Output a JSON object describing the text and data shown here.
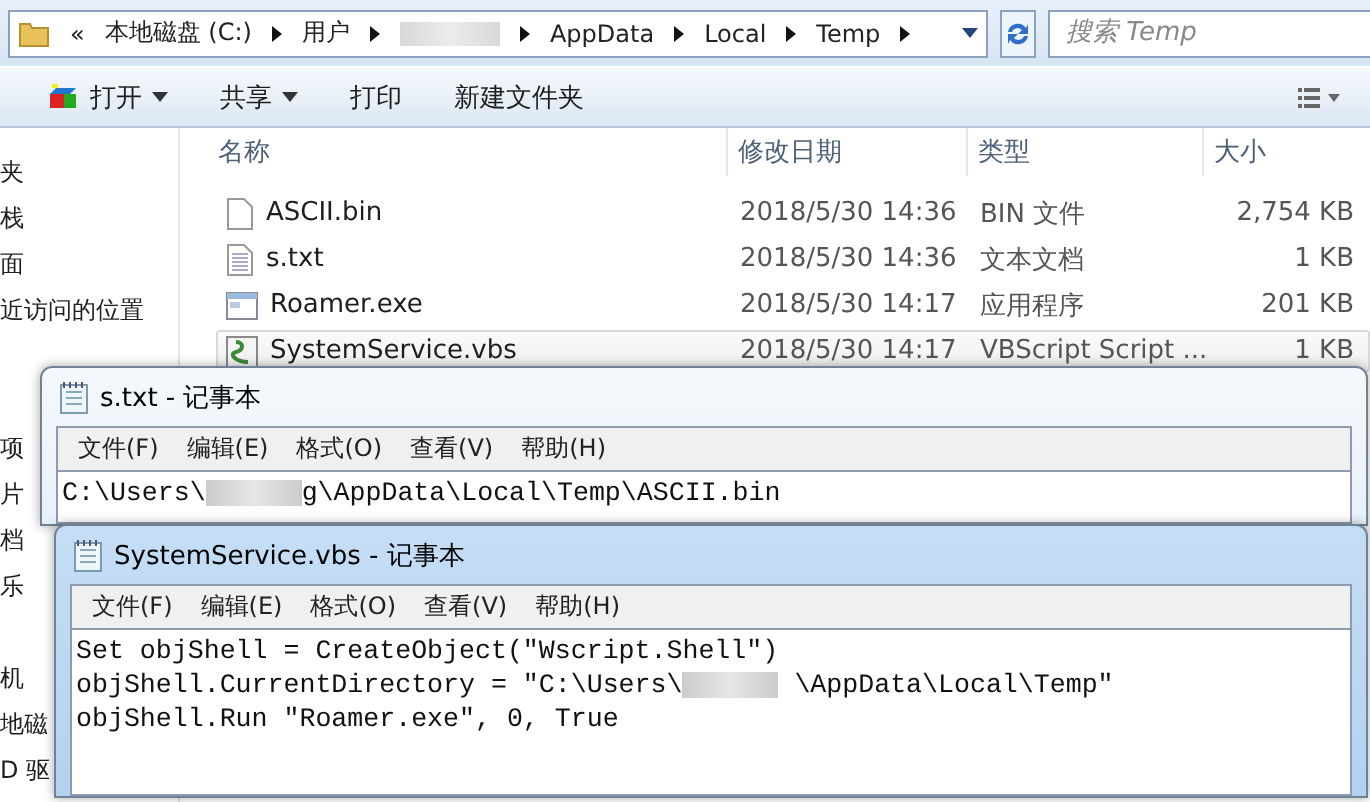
{
  "explorer": {
    "address": {
      "overflow": "«",
      "crumbs": [
        {
          "kind": "text",
          "text": "本地磁盘 (C:)"
        },
        {
          "kind": "text",
          "text": "用户"
        },
        {
          "kind": "redacted"
        },
        {
          "kind": "text",
          "text": "AppData"
        },
        {
          "kind": "text",
          "text": "Local"
        },
        {
          "kind": "text",
          "text": "Temp"
        }
      ]
    },
    "search": {
      "placeholder": "搜索 Temp"
    },
    "toolbar": [
      {
        "label": "打开",
        "kind": "icon-menu"
      },
      {
        "label": "共享",
        "kind": "menu"
      },
      {
        "label": "打印",
        "kind": "plain"
      },
      {
        "label": "新建文件夹",
        "kind": "plain"
      }
    ],
    "sidebar": [
      [
        "夹",
        "栈",
        "面",
        "近访问的位置"
      ],
      [
        "项",
        "片",
        "档",
        "乐"
      ],
      [
        "机",
        "地磁",
        "D 驱"
      ]
    ],
    "columns": [
      "名称",
      "修改日期",
      "类型",
      "大小"
    ],
    "files": [
      {
        "name": "ASCII.bin",
        "modified": "2018/5/30 14:36",
        "type": "BIN 文件",
        "size": "2,754 KB",
        "kind": "blank",
        "selected": false
      },
      {
        "name": "s.txt",
        "modified": "2018/5/30 14:36",
        "type": "文本文档",
        "size": "1 KB",
        "kind": "text",
        "selected": false
      },
      {
        "name": "Roamer.exe",
        "modified": "2018/5/30 14:17",
        "type": "应用程序",
        "size": "201 KB",
        "kind": "app",
        "selected": false
      },
      {
        "name": "SystemService.vbs",
        "modified": "2018/5/30 14:17",
        "type": "VBScript Script ...",
        "size": "1 KB",
        "kind": "script",
        "selected": true
      }
    ]
  },
  "notepads": [
    {
      "title": "s.txt - 记事本",
      "active": false,
      "menu": [
        "文件(F)",
        "编辑(E)",
        "格式(O)",
        "查看(V)",
        "帮助(H)"
      ],
      "lines": [
        [
          {
            "kind": "text",
            "text": "C:\\Users\\"
          },
          {
            "kind": "redacted"
          },
          {
            "kind": "text",
            "text": "g\\AppData\\Local\\Temp\\ASCII.bin"
          }
        ]
      ]
    },
    {
      "title": "SystemService.vbs - 记事本",
      "active": true,
      "menu": [
        "文件(F)",
        "编辑(E)",
        "格式(O)",
        "查看(V)",
        "帮助(H)"
      ],
      "lines": [
        [
          {
            "kind": "text",
            "text": "Set objShell = CreateObject(\"Wscript.Shell\")"
          }
        ],
        [
          {
            "kind": "text",
            "text": "objShell.CurrentDirectory = \"C:\\Users\\"
          },
          {
            "kind": "redacted"
          },
          {
            "kind": "text",
            "text": " \\AppData\\Local\\Temp\""
          }
        ],
        [
          {
            "kind": "text",
            "text": "objShell.Run \"Roamer.exe\", 0, True"
          }
        ]
      ]
    }
  ]
}
